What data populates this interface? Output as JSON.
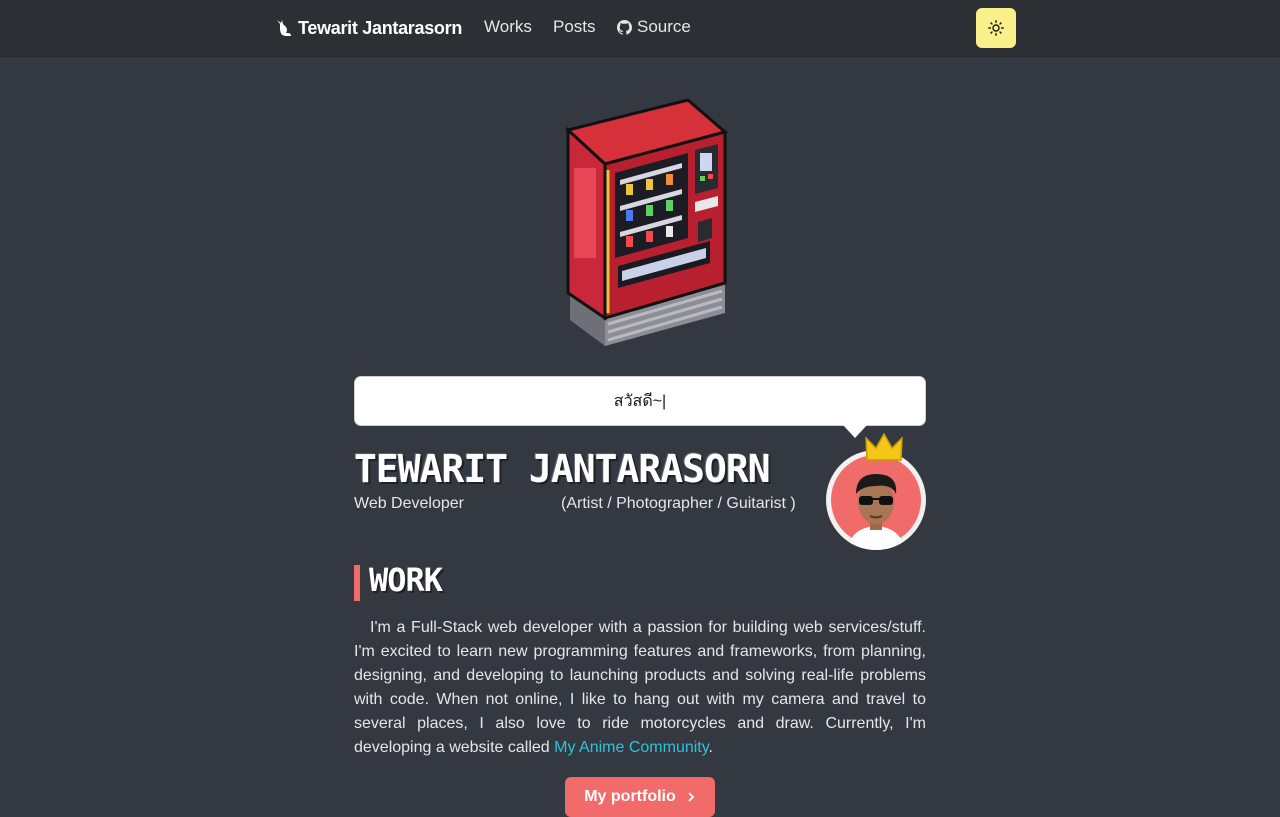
{
  "nav": {
    "brand": "Tewarit Jantarasorn",
    "works": "Works",
    "posts": "Posts",
    "source": "Source",
    "theme_icon": "sun-icon"
  },
  "hero": {
    "greeting": "สวัสดี~|",
    "name": "TEWARIT JANTARASORN",
    "role": "Web Developer",
    "role_extra": "(Artist / Photographer / Guitarist )"
  },
  "work": {
    "title": "WORK",
    "bio_text": "I'm a Full-Stack web developer with a passion for building web services/stuff. I'm excited to learn new programming features and frameworks, from planning, designing, and developing to launching products and solving real-life problems with code. When not online, I like to hang out with my camera and travel to several places, I also love to ride motorcycles and draw. Currently, I'm developing a website called ",
    "bio_link": "My Anime Community",
    "bio_end": ".",
    "portfolio_button": "My portfolio"
  },
  "colors": {
    "background": "#343840",
    "nav": "#2c2f34",
    "accent": "#f16b6b",
    "link": "#2cc4d8",
    "theme_button": "#faf089"
  }
}
